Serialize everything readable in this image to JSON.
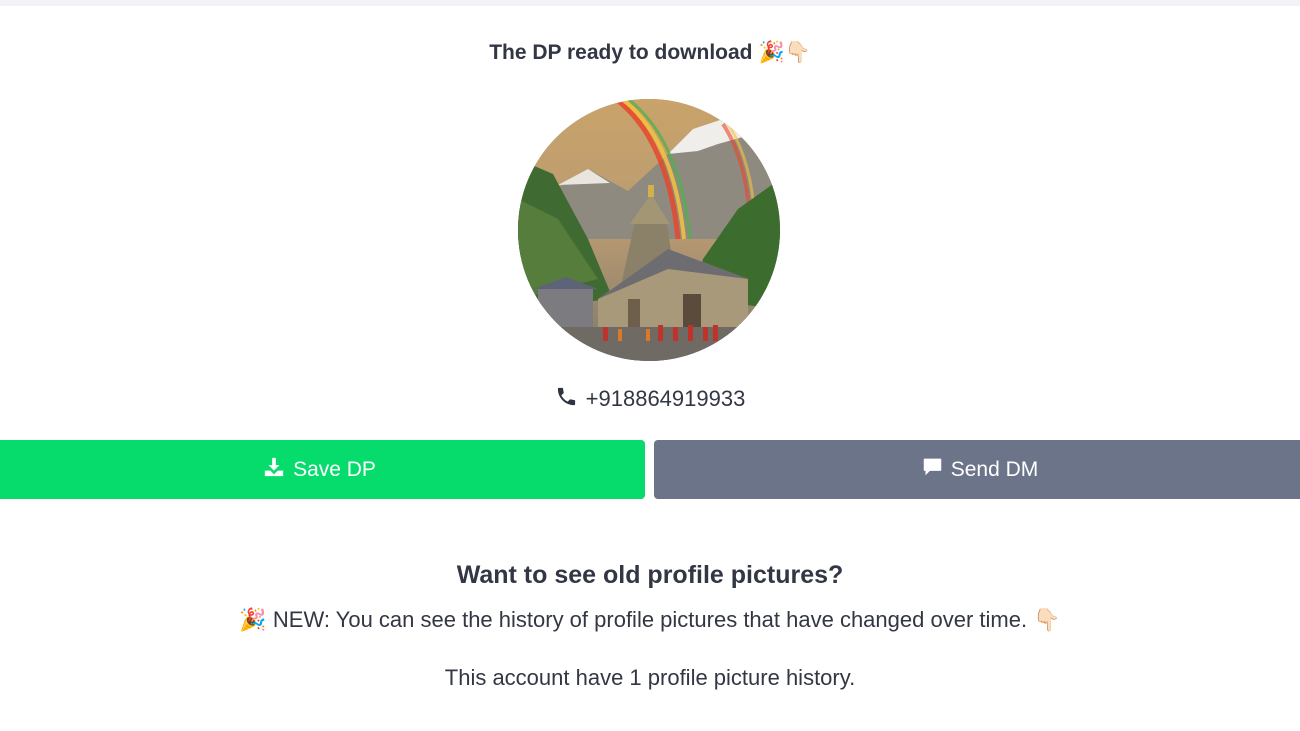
{
  "header": {
    "title": "The DP ready to download",
    "title_emoji": "🎉👇🏻"
  },
  "profile": {
    "image_alt": "profile picture",
    "phone": "+918864919933",
    "phone_icon": "phone-icon"
  },
  "actions": {
    "save_label": "Save DP",
    "save_icon": "download-icon",
    "save_color": "#05dc6c",
    "dm_label": "Send DM",
    "dm_icon": "message-icon",
    "dm_color": "#6c7489"
  },
  "history": {
    "title": "Want to see old profile pictures?",
    "new_emoji": "🎉",
    "new_text": "NEW: You can see the history of profile pictures that have changed over time.",
    "new_emoji_end": "👇🏻",
    "count_text": "This account have 1 profile picture history."
  }
}
